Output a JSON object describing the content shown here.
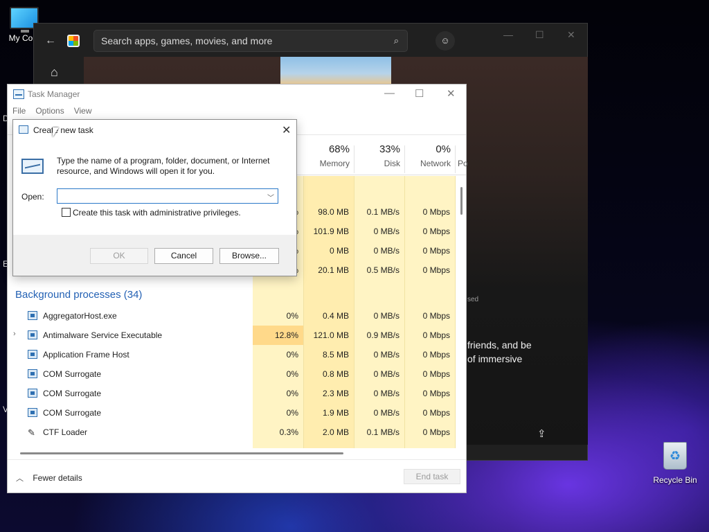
{
  "desktop": {
    "my_computer_label": "My Com",
    "recycle_bin_label": "Recycle Bin",
    "edge_letters": [
      "D",
      "E",
      "V"
    ]
  },
  "store": {
    "search_placeholder": "Search apps, games, movies, and more",
    "desc_line1": "friends, and be",
    "desc_line2": "of immersive",
    "small_text": "sed"
  },
  "task_manager": {
    "title": "Task Manager",
    "menu": [
      "File",
      "Options",
      "View"
    ],
    "columns": {
      "memory": {
        "pct": "68%",
        "label": "Memory"
      },
      "disk": {
        "pct": "33%",
        "label": "Disk"
      },
      "network": {
        "pct": "0%",
        "label": "Network"
      },
      "power_partial": "Po"
    },
    "app_rows": [
      {
        "cpu": "%",
        "memory": "98.0 MB",
        "disk": "0.1 MB/s",
        "network": "0 Mbps"
      },
      {
        "cpu": "%",
        "memory": "101.9 MB",
        "disk": "0 MB/s",
        "network": "0 Mbps"
      },
      {
        "cpu": "%",
        "memory": "0 MB",
        "disk": "0 MB/s",
        "network": "0 Mbps"
      },
      {
        "cpu": "%",
        "memory": "20.1 MB",
        "disk": "0.5 MB/s",
        "network": "0 Mbps"
      }
    ],
    "background_title": "Background processes (34)",
    "processes": [
      {
        "name": "AggregatorHost.exe",
        "cpu": "0%",
        "memory": "0.4 MB",
        "disk": "0 MB/s",
        "network": "0 Mbps"
      },
      {
        "name": "Antimalware Service Executable",
        "cpu": "12.8%",
        "memory": "121.0 MB",
        "disk": "0.9 MB/s",
        "network": "0 Mbps"
      },
      {
        "name": "Application Frame Host",
        "cpu": "0%",
        "memory": "8.5 MB",
        "disk": "0 MB/s",
        "network": "0 Mbps"
      },
      {
        "name": "COM Surrogate",
        "cpu": "0%",
        "memory": "0.8 MB",
        "disk": "0 MB/s",
        "network": "0 Mbps"
      },
      {
        "name": "COM Surrogate",
        "cpu": "0%",
        "memory": "2.3 MB",
        "disk": "0 MB/s",
        "network": "0 Mbps"
      },
      {
        "name": "COM Surrogate",
        "cpu": "0%",
        "memory": "1.9 MB",
        "disk": "0 MB/s",
        "network": "0 Mbps"
      },
      {
        "name": "CTF Loader",
        "cpu": "0.3%",
        "memory": "2.0 MB",
        "disk": "0.1 MB/s",
        "network": "0 Mbps"
      }
    ],
    "fewer_details": "Fewer details",
    "end_task": "End task"
  },
  "dialog": {
    "title": "Create new task",
    "message": "Type the name of a program, folder, document, or Internet resource, and Windows will open it for you.",
    "open_label": "Open:",
    "open_value": "",
    "admin_checkbox_label": "Create this task with administrative privileges.",
    "ok": "OK",
    "cancel": "Cancel",
    "browse": "Browse..."
  }
}
